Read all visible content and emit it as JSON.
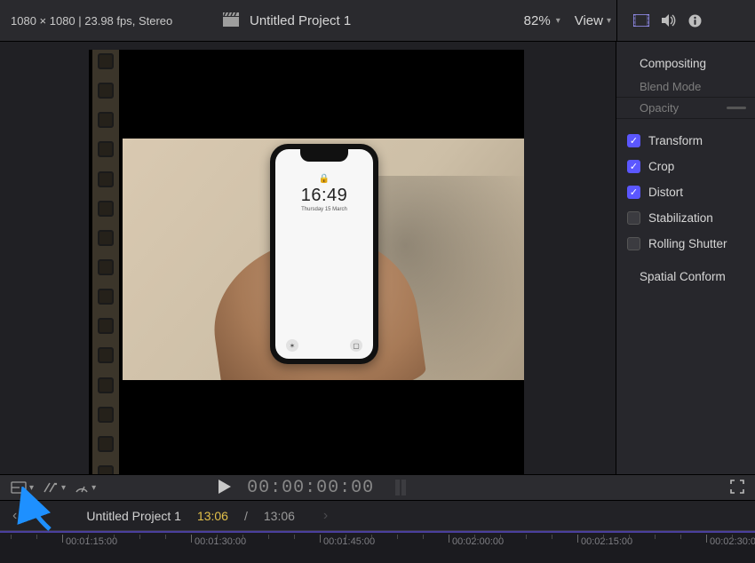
{
  "header": {
    "project_info": "1080 × 1080 | 23.98 fps, Stereo",
    "clapper_icon": "clapper-icon",
    "project_title": "Untitled Project 1",
    "zoom": "82%",
    "view_label": "View"
  },
  "inspector_tabs": {
    "video_icon": "video-inspector-icon",
    "audio_icon": "audio-inspector-icon",
    "info_icon": "info-inspector-icon"
  },
  "inspector": {
    "compositing": "Compositing",
    "blend_mode": "Blend Mode",
    "opacity": "Opacity",
    "transform": "Transform",
    "crop": "Crop",
    "distort": "Distort",
    "stabilization": "Stabilization",
    "rolling_shutter": "Rolling Shutter",
    "spatial_conform": "Spatial Conform"
  },
  "phone": {
    "time": "16:49",
    "date": "Thursday 15 March"
  },
  "transport": {
    "effects_icon": "effects-popup-icon",
    "retime_icon": "retime-icon",
    "speed_icon": "clip-speed-icon",
    "play_icon": "play-icon",
    "timecode": "00:00:00:00",
    "fullscreen_icon": "fullscreen-icon"
  },
  "timeline_header": {
    "back_icon": "history-back-icon",
    "title": "Untitled Project 1",
    "current": "13:06",
    "separator": "/",
    "duration": "13:06",
    "fwd_icon": "history-forward-icon"
  },
  "ruler": {
    "majors": [
      {
        "pos": 70,
        "label": "00:01:15:00"
      },
      {
        "pos": 215,
        "label": "00:01:30:00"
      },
      {
        "pos": 360,
        "label": "00:01:45:00"
      },
      {
        "pos": 505,
        "label": "00:02:00:00"
      },
      {
        "pos": 650,
        "label": "00:02:15:00"
      },
      {
        "pos": 795,
        "label": "00:02:30:00"
      }
    ],
    "minors_per_gap": 4
  },
  "arrow_color": "#1e90ff"
}
